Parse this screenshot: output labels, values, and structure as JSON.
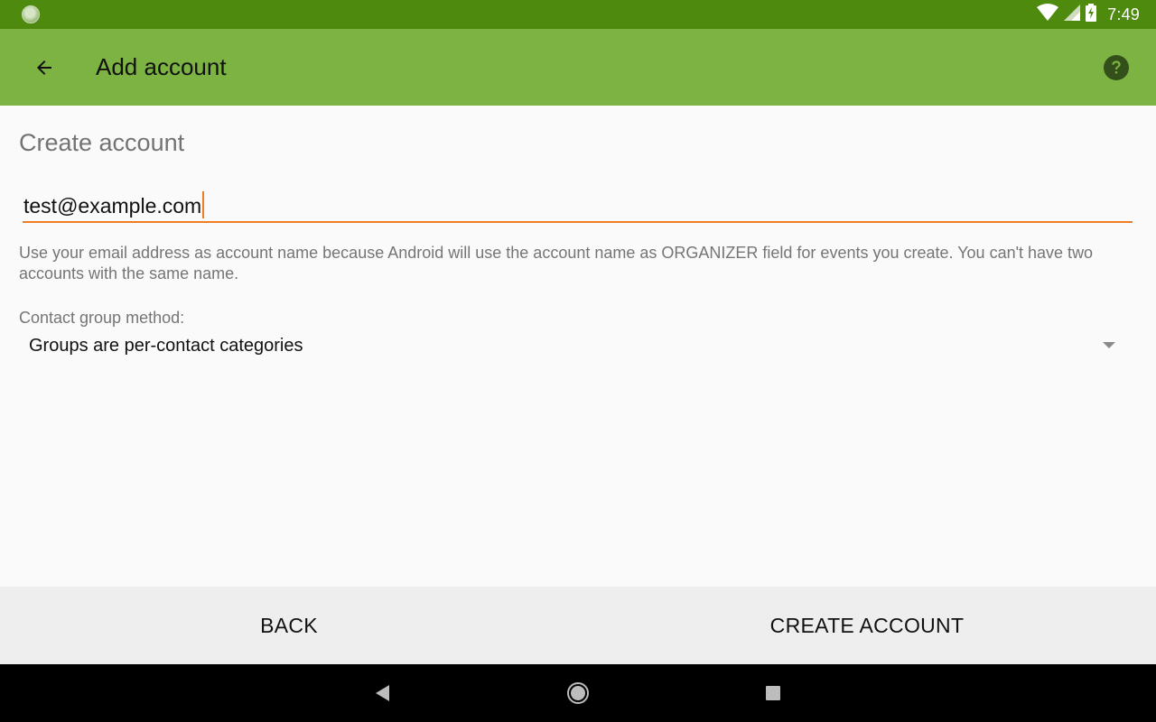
{
  "status_bar": {
    "time": "7:49",
    "icons": [
      "notification-dot-icon",
      "wifi-icon",
      "cell-signal-icon",
      "battery-charging-icon"
    ]
  },
  "toolbar": {
    "title": "Add account",
    "back_icon": "arrow-back-icon",
    "help_icon": "help-icon"
  },
  "form": {
    "section_title": "Create account",
    "email_value": "test@example.com",
    "help_text": "Use your email address as account name because Android will use the account name as ORGANIZER field for events you create. You can't have two accounts with the same name.",
    "group_method_label": "Contact group method:",
    "group_method_value": "Groups are per-contact categories"
  },
  "buttons": {
    "back": "BACK",
    "create": "CREATE ACCOUNT"
  },
  "nav_bar": {
    "icons": [
      "nav-back-icon",
      "nav-home-icon",
      "nav-recents-icon"
    ]
  },
  "colors": {
    "status_bar": "#4e8a0e",
    "toolbar": "#7cb342",
    "accent": "#ef7d22",
    "button_bar": "#eeeeee"
  }
}
